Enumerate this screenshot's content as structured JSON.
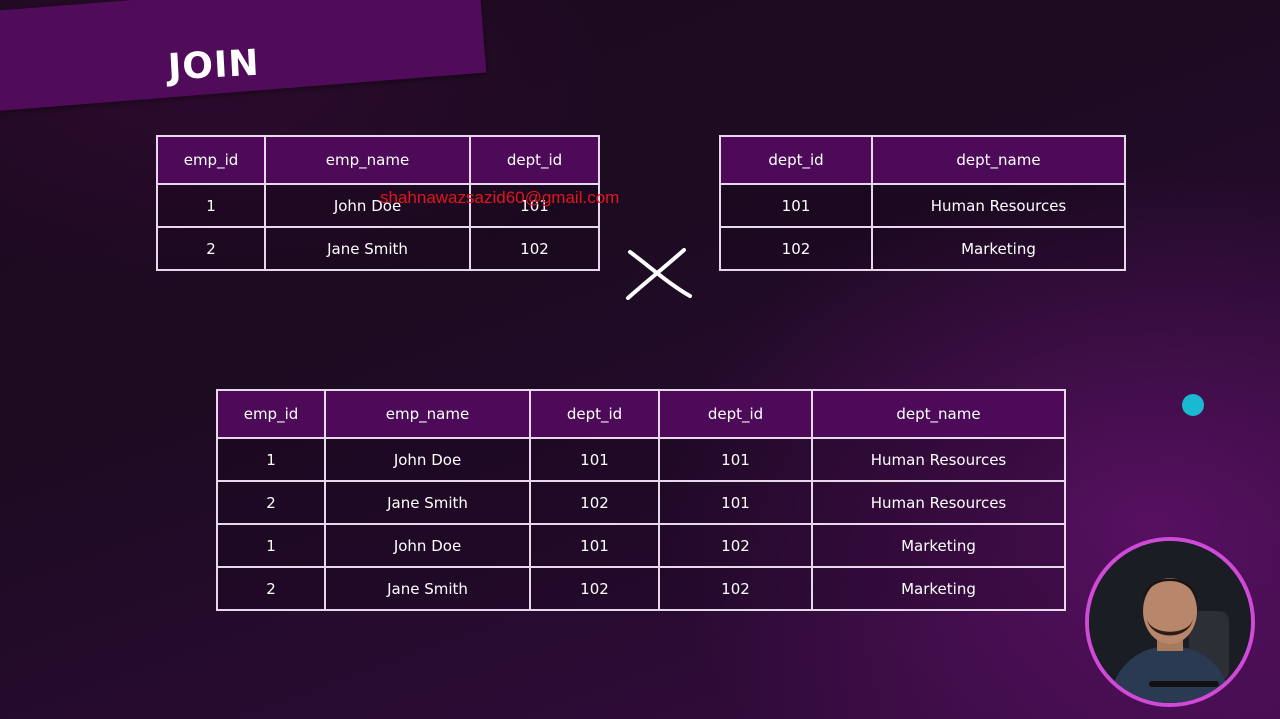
{
  "slide": {
    "title": "JOIN"
  },
  "watermark": "shahnawazsazid60@gmail.com",
  "colors": {
    "header_fill": "#4d0a58",
    "banner": "#500c5a",
    "border": "#e8d8ec",
    "pointer": "#19b9d2",
    "webcam_ring": "#d04ad8"
  },
  "icons": {
    "operator": "cross-product-icon"
  },
  "employees_table": {
    "headers": [
      "emp_id",
      "emp_name",
      "dept_id"
    ],
    "rows": [
      [
        "1",
        "John Doe",
        "101"
      ],
      [
        "2",
        "Jane Smith",
        "102"
      ]
    ]
  },
  "departments_table": {
    "headers": [
      "dept_id",
      "dept_name"
    ],
    "rows": [
      [
        "101",
        "Human Resources"
      ],
      [
        "102",
        "Marketing"
      ]
    ]
  },
  "result_table": {
    "headers": [
      "emp_id",
      "emp_name",
      "dept_id",
      "dept_id",
      "dept_name"
    ],
    "rows": [
      [
        "1",
        "John Doe",
        "101",
        "101",
        "Human Resources"
      ],
      [
        "2",
        "Jane Smith",
        "102",
        "101",
        "Human Resources"
      ],
      [
        "1",
        "John Doe",
        "101",
        "102",
        "Marketing"
      ],
      [
        "2",
        "Jane Smith",
        "102",
        "102",
        "Marketing"
      ]
    ]
  }
}
